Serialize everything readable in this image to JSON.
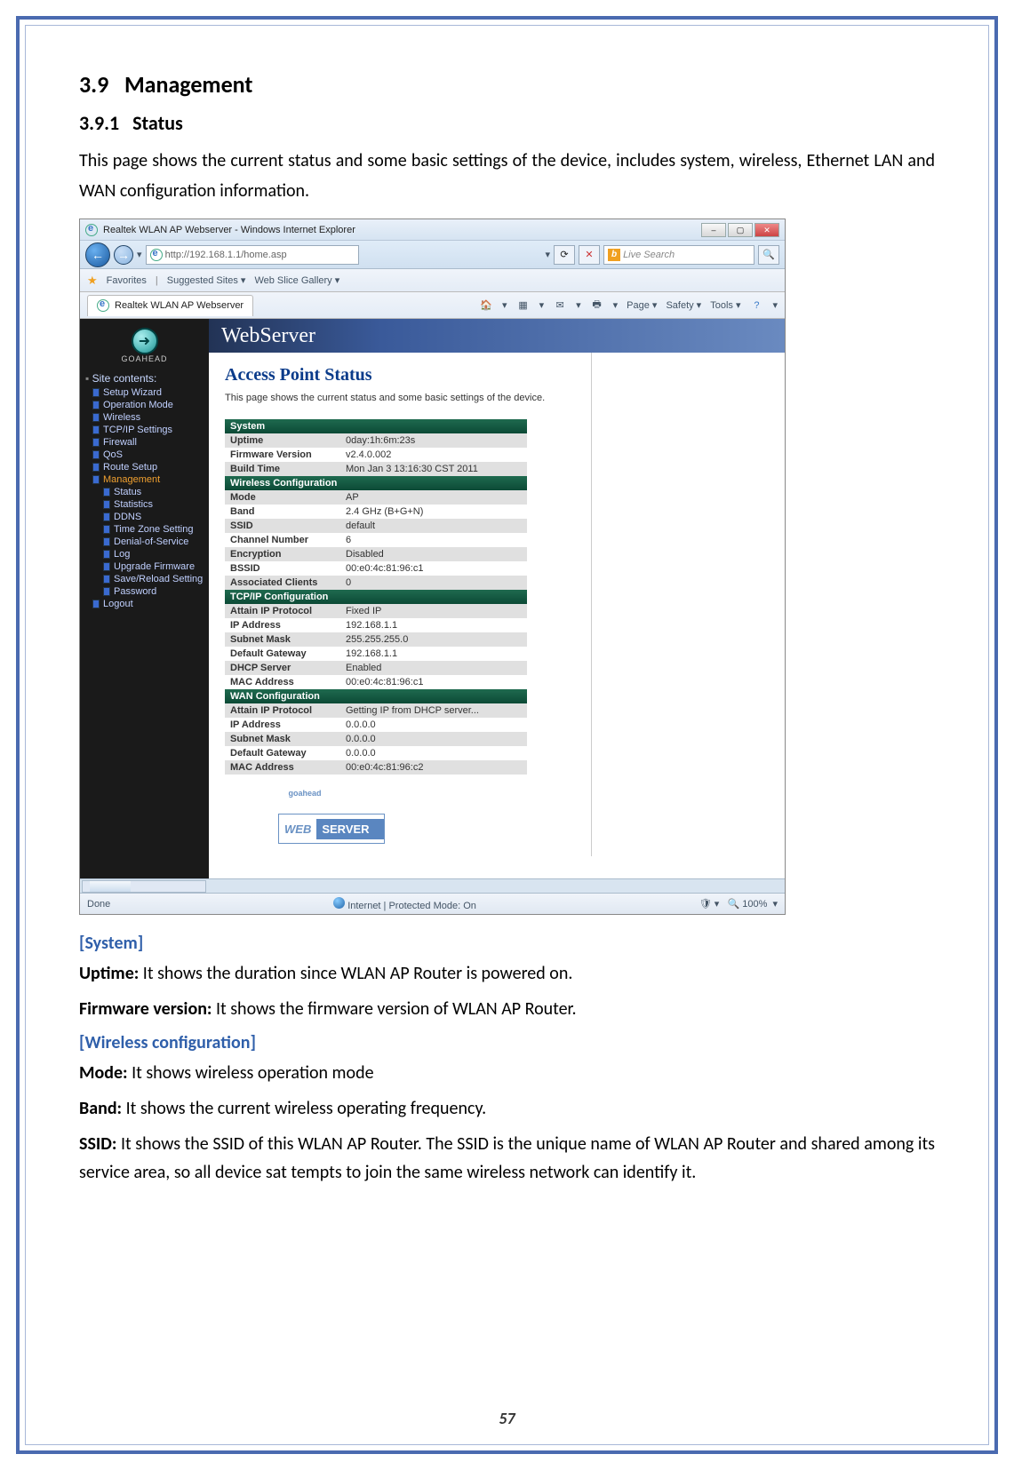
{
  "section_num": "3.9",
  "section_title": "Management",
  "subsection_num": "3.9.1",
  "subsection_title": "Status",
  "intro": "This page shows the current status and some basic settings of the device, includes system, wireless, Ethernet LAN and WAN configuration information.",
  "page_number": "57",
  "browser": {
    "window_title": "Realtek WLAN AP Webserver - Windows Internet Explorer",
    "url": "http://192.168.1.1/home.asp",
    "search_placeholder": "Live Search",
    "favorites_label": "Favorites",
    "fav_links": [
      "Suggested Sites ▾",
      "Web Slice Gallery ▾"
    ],
    "tab_title": "Realtek WLAN AP Webserver",
    "cmd_items": [
      "Page ▾",
      "Safety ▾",
      "Tools ▾"
    ],
    "status_left": "Done",
    "status_mid": "Internet | Protected Mode: On",
    "status_zoom": "100%"
  },
  "webapp": {
    "brand": "WebServer",
    "goahead": "GOAHEAD",
    "sidebar_header": "Site contents:",
    "sidebar": [
      {
        "label": "Setup Wizard",
        "lvl": 1
      },
      {
        "label": "Operation Mode",
        "lvl": 1
      },
      {
        "label": "Wireless",
        "lvl": 1
      },
      {
        "label": "TCP/IP Settings",
        "lvl": 1
      },
      {
        "label": "Firewall",
        "lvl": 1
      },
      {
        "label": "QoS",
        "lvl": 1
      },
      {
        "label": "Route Setup",
        "lvl": 1
      },
      {
        "label": "Management",
        "lvl": 1,
        "active": true
      },
      {
        "label": "Status",
        "lvl": 2
      },
      {
        "label": "Statistics",
        "lvl": 2
      },
      {
        "label": "DDNS",
        "lvl": 2
      },
      {
        "label": "Time Zone Setting",
        "lvl": 2
      },
      {
        "label": "Denial-of-Service",
        "lvl": 2
      },
      {
        "label": "Log",
        "lvl": 2
      },
      {
        "label": "Upgrade Firmware",
        "lvl": 2
      },
      {
        "label": "Save/Reload Setting",
        "lvl": 2
      },
      {
        "label": "Password",
        "lvl": 2
      },
      {
        "label": "Logout",
        "lvl": 1
      }
    ],
    "page_title": "Access Point Status",
    "page_desc": "This page shows the current status and some basic settings of the device.",
    "tables": [
      {
        "header": "System",
        "rows": [
          [
            "Uptime",
            "0day:1h:6m:23s"
          ],
          [
            "Firmware Version",
            "v2.4.0.002"
          ],
          [
            "Build Time",
            "Mon Jan 3 13:16:30 CST 2011"
          ]
        ]
      },
      {
        "header": "Wireless Configuration",
        "rows": [
          [
            "Mode",
            "AP"
          ],
          [
            "Band",
            "2.4 GHz (B+G+N)"
          ],
          [
            "SSID",
            "default"
          ],
          [
            "Channel Number",
            "6"
          ],
          [
            "Encryption",
            "Disabled"
          ],
          [
            "BSSID",
            "00:e0:4c:81:96:c1"
          ],
          [
            "Associated Clients",
            "0"
          ]
        ]
      },
      {
        "header": "TCP/IP Configuration",
        "rows": [
          [
            "Attain IP Protocol",
            "Fixed IP"
          ],
          [
            "IP Address",
            "192.168.1.1"
          ],
          [
            "Subnet Mask",
            "255.255.255.0"
          ],
          [
            "Default Gateway",
            "192.168.1.1"
          ],
          [
            "DHCP Server",
            "Enabled"
          ],
          [
            "MAC Address",
            "00:e0:4c:81:96:c1"
          ]
        ]
      },
      {
        "header": "WAN Configuration",
        "rows": [
          [
            "Attain IP Protocol",
            "Getting IP from DHCP server..."
          ],
          [
            "IP Address",
            "0.0.0.0"
          ],
          [
            "Subnet Mask",
            "0.0.0.0"
          ],
          [
            "Default Gateway",
            "0.0.0.0"
          ],
          [
            "MAC Address",
            "00:e0:4c:81:96:c2"
          ]
        ]
      }
    ],
    "badge_left": "WEB",
    "badge_right": "SERVER",
    "badge_top": "goahead"
  },
  "defs": {
    "system_hdr": "[System]",
    "uptime_k": "Uptime:",
    "uptime_v": " It shows the duration since WLAN AP Router is powered on.",
    "fw_k": "Firmware version:",
    "fw_v": " It shows the firmware version of WLAN AP Router.",
    "wireless_hdr": "[Wireless configuration]",
    "mode_k": "Mode:",
    "mode_v": " It shows wireless operation mode",
    "band_k": "Band:",
    "band_v": " It shows the current wireless operating frequency.",
    "ssid_k": "SSID:",
    "ssid_v": " It shows the SSID of this WLAN AP Router. The SSID is the unique name of WLAN AP Router and shared among its service area, so all device sat tempts to join the same wireless network can identify it."
  }
}
